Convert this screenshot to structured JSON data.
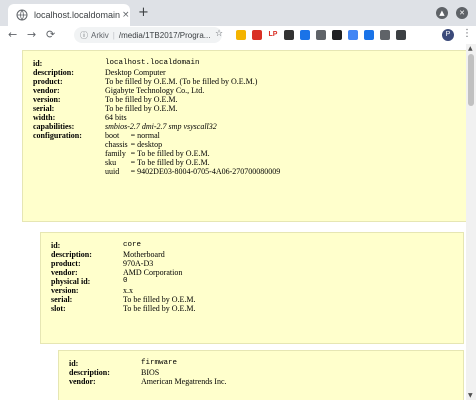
{
  "browser": {
    "tab_title": "localhost.localdomain",
    "tab_close": "×",
    "new_tab": "+",
    "omnibox_label": "Arkiv",
    "url": "/media/1TB2017/Progra...",
    "avatar_letter": "P",
    "extensions": [
      {
        "name": "drive-icon",
        "color": "#f4b400",
        "label": ""
      },
      {
        "name": "extension-red-icon",
        "color": "#d93025",
        "label": ""
      },
      {
        "name": "lp-icon",
        "color": "#ffffff",
        "label": "LP"
      },
      {
        "name": "bird-icon",
        "color": "#333333",
        "label": ""
      },
      {
        "name": "pocket-icon",
        "color": "#1a73e8",
        "label": ""
      },
      {
        "name": "shield-icon",
        "color": "#5f6368",
        "label": ""
      },
      {
        "name": "card-icon",
        "color": "#202124",
        "label": ""
      },
      {
        "name": "cloud-icon",
        "color": "#4285f4",
        "label": ""
      },
      {
        "name": "x-icon",
        "color": "#1a73e8",
        "label": ""
      },
      {
        "name": "puzzle-icon",
        "color": "#5f6368",
        "label": ""
      },
      {
        "name": "settings-ext-icon",
        "color": "#3c4043",
        "label": ""
      }
    ]
  },
  "nodes": {
    "root": {
      "id": "localhost.localdomain",
      "description": "Desktop Computer",
      "product": "To be filled by O.E.M. (To be filled by O.E.M.)",
      "vendor": "Gigabyte Technology Co., Ltd.",
      "version": "To be filled by O.E.M.",
      "serial": "To be filled by O.E.M.",
      "width": "64 bits",
      "capabilities": "smbios-2.7 dmi-2.7 smp vsyscall32",
      "configuration": [
        {
          "key": "boot",
          "value": "= normal"
        },
        {
          "key": "chassis",
          "value": "= desktop"
        },
        {
          "key": "family",
          "value": "= To be filled by O.E.M."
        },
        {
          "key": "sku",
          "value": "= To be filled by O.E.M."
        },
        {
          "key": "uuid",
          "value": "= 9402DE03-8004-0705-4A06-270700080009"
        }
      ]
    },
    "core": {
      "id": "core",
      "description": "Motherboard",
      "product": "970A-D3",
      "vendor": "AMD Corporation",
      "physical_id": "0",
      "version": "x.x",
      "serial": "To be filled by O.E.M.",
      "slot": "To be filled by O.E.M."
    },
    "firmware": {
      "id": "firmware",
      "description": "BIOS",
      "vendor": "American Megatrends Inc."
    }
  },
  "labels": {
    "id": "id:",
    "description": "description:",
    "product": "product:",
    "vendor": "vendor:",
    "physical_id": "physical id:",
    "version": "version:",
    "serial": "serial:",
    "slot": "slot:",
    "width": "width:",
    "capabilities": "capabilities:",
    "configuration": "configuration:"
  }
}
